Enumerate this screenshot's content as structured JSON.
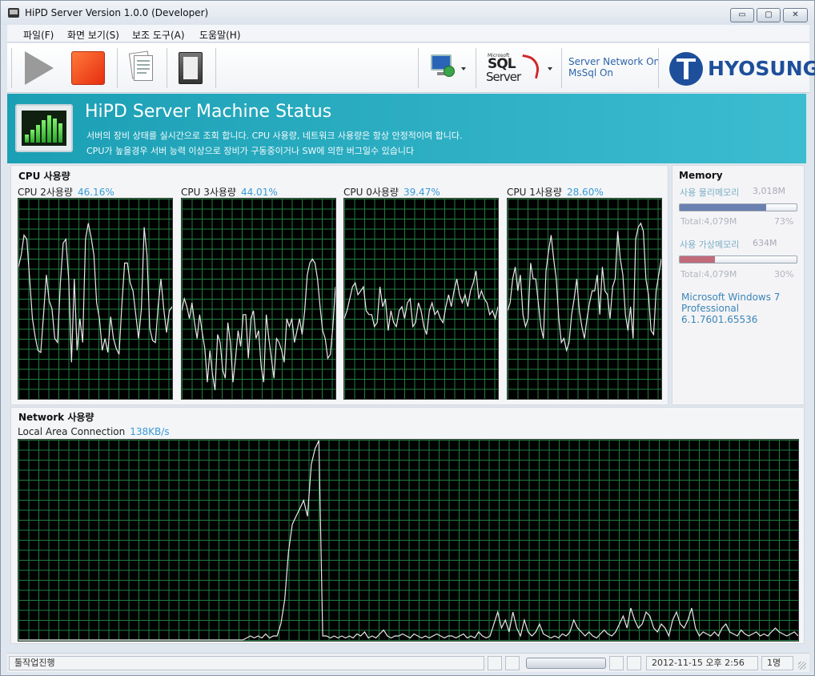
{
  "window": {
    "title": "HiPD Server Version 1.0.0 (Developer)",
    "controls": {
      "minimize": "▭",
      "maximize": "▢",
      "close": "✕"
    }
  },
  "menu": [
    "파일(F)",
    "화면 보기(S)",
    "보조 도구(A)",
    "도움말(H)"
  ],
  "toolbar": {
    "buttons": [
      "play-icon",
      "stop-icon",
      "report-icon",
      "file-icon",
      "network-icon",
      "sql-server-icon"
    ],
    "sql_logo": {
      "microsoft": "Microsoft",
      "sql": "SQL",
      "server": "Server"
    },
    "status_lines": [
      "Server Network On",
      "MsSql On"
    ],
    "logo_text": "HYOSUNG",
    "colors": {
      "stop": "#e62d10",
      "accent": "#1d4f9a"
    }
  },
  "banner": {
    "title": "HiPD Server Machine Status",
    "line1": "서버의 장비 상태를 실시간으로 조회 합니다. CPU 사용량, 네트워크 사용량은 항상 안정적이여 합니다.",
    "line2": "CPU가 높을경우 서버 능력 이상으로 장비가 구동중이거나 SW에 의한 버그일수 있습니다",
    "color": "#1b9fb4"
  },
  "cpu": {
    "section_title": "CPU 사용량",
    "graphs": [
      {
        "label": "CPU 2사용량",
        "value": "46.16%",
        "samples": [
          66,
          72,
          82,
          80,
          60,
          40,
          31,
          24,
          23,
          42,
          62,
          49,
          45,
          30,
          28,
          58,
          78,
          80,
          60,
          18,
          60,
          24,
          40,
          28,
          80,
          88,
          81,
          72,
          48,
          40,
          24,
          30,
          23,
          41,
          30,
          25,
          22,
          47,
          68,
          68,
          58,
          54,
          42,
          30,
          45,
          86,
          72,
          35,
          29,
          28,
          46,
          60,
          45,
          33,
          44,
          46
        ]
      },
      {
        "label": "CPU 3사용량",
        "value": "44.01%",
        "samples": [
          44,
          50,
          46,
          40,
          48,
          38,
          30,
          42,
          33,
          25,
          8,
          24,
          12,
          4,
          32,
          28,
          14,
          10,
          38,
          28,
          8,
          20,
          34,
          26,
          42,
          42,
          20,
          40,
          44,
          30,
          34,
          16,
          8,
          42,
          30,
          20,
          10,
          30,
          28,
          24,
          18,
          40,
          36,
          40,
          28,
          34,
          40,
          32,
          44,
          62,
          68,
          70,
          68,
          60,
          46,
          34,
          30,
          20,
          22,
          36,
          56
        ]
      },
      {
        "label": "CPU 0사용량",
        "value": "39.47%",
        "samples": [
          40,
          44,
          50,
          56,
          58,
          52,
          54,
          56,
          44,
          42,
          42,
          36,
          38,
          56,
          46,
          50,
          34,
          44,
          38,
          36,
          44,
          46,
          40,
          48,
          50,
          36,
          38,
          48,
          44,
          36,
          32,
          44,
          48,
          42,
          44,
          40,
          38,
          46,
          52,
          46,
          54,
          60,
          52,
          48,
          52,
          46,
          54,
          58,
          64,
          50,
          54,
          50,
          48,
          42,
          44,
          40,
          46
        ]
      },
      {
        "label": "CPU 1사용량",
        "value": "28.60%",
        "samples": [
          44,
          48,
          60,
          66,
          54,
          62,
          42,
          36,
          40,
          68,
          60,
          60,
          48,
          36,
          30,
          64,
          74,
          82,
          70,
          60,
          40,
          28,
          30,
          24,
          28,
          42,
          50,
          60,
          44,
          36,
          30,
          40,
          48,
          54,
          54,
          62,
          42,
          66,
          54,
          52,
          40,
          56,
          60,
          84,
          70,
          62,
          42,
          34,
          46,
          30,
          80,
          86,
          88,
          84,
          60,
          52,
          34,
          32,
          54,
          62,
          70
        ]
      }
    ]
  },
  "memory": {
    "section_title": "Memory",
    "physical": {
      "label": "사용 물리메모리",
      "value": "3,018M",
      "total": "Total:4,079M",
      "percent": "73%",
      "fraction": 0.74,
      "color": "#6b7fb0"
    },
    "virtual": {
      "label": "사용 가상메모리",
      "value": "634M",
      "total": "Total:4,079M",
      "percent": "30%",
      "fraction": 0.3,
      "color": "#c06a7a"
    },
    "os_lines": [
      "Microsoft Windows 7",
      "Professional",
      "6.1.7601.65536"
    ]
  },
  "network": {
    "section_title": "Network 사용량",
    "label": "Local Area Connection",
    "value": "138KB/s",
    "samples": [
      0,
      0,
      0,
      0,
      0,
      0,
      0,
      0,
      0,
      0,
      0,
      0,
      0,
      0,
      0,
      0,
      0,
      0,
      0,
      0,
      0,
      0,
      0,
      0,
      0,
      0,
      0,
      0,
      0,
      0,
      0,
      0,
      0,
      0,
      0,
      0,
      0,
      0,
      0,
      0,
      0,
      0,
      0,
      0,
      0,
      0,
      0,
      0,
      0,
      0,
      0,
      0,
      0,
      0,
      0,
      0,
      0,
      0,
      0,
      0,
      1,
      2,
      1,
      2,
      1,
      3,
      1,
      2,
      2,
      8,
      20,
      44,
      58,
      62,
      66,
      70,
      62,
      88,
      96,
      100,
      2,
      2,
      1,
      2,
      1,
      2,
      1,
      2,
      1,
      3,
      2,
      4,
      1,
      2,
      1,
      3,
      5,
      2,
      1,
      2,
      2,
      3,
      2,
      1,
      3,
      2,
      1,
      2,
      1,
      2,
      3,
      2,
      1,
      2,
      2,
      1,
      2,
      3,
      1,
      2,
      1,
      4,
      2,
      1,
      2,
      8,
      14,
      6,
      10,
      4,
      14,
      6,
      2,
      10,
      4,
      2,
      4,
      8,
      3,
      2,
      1,
      2,
      1,
      3,
      2,
      4,
      10,
      6,
      4,
      2,
      4,
      2,
      1,
      3,
      5,
      3,
      2,
      4,
      8,
      12,
      6,
      16,
      10,
      6,
      8,
      14,
      12,
      6,
      4,
      8,
      6,
      2,
      10,
      14,
      8,
      6,
      10,
      16,
      6,
      2,
      4,
      3,
      2,
      4,
      2,
      6,
      8,
      4,
      3,
      2,
      5,
      3,
      2,
      3,
      4,
      2,
      3,
      2,
      4,
      6,
      4,
      3,
      2,
      3,
      4,
      2
    ]
  },
  "statusbar": {
    "message": "툴작업진행",
    "datetime": "2012-11-15 오후 2:56",
    "users": "1명"
  }
}
